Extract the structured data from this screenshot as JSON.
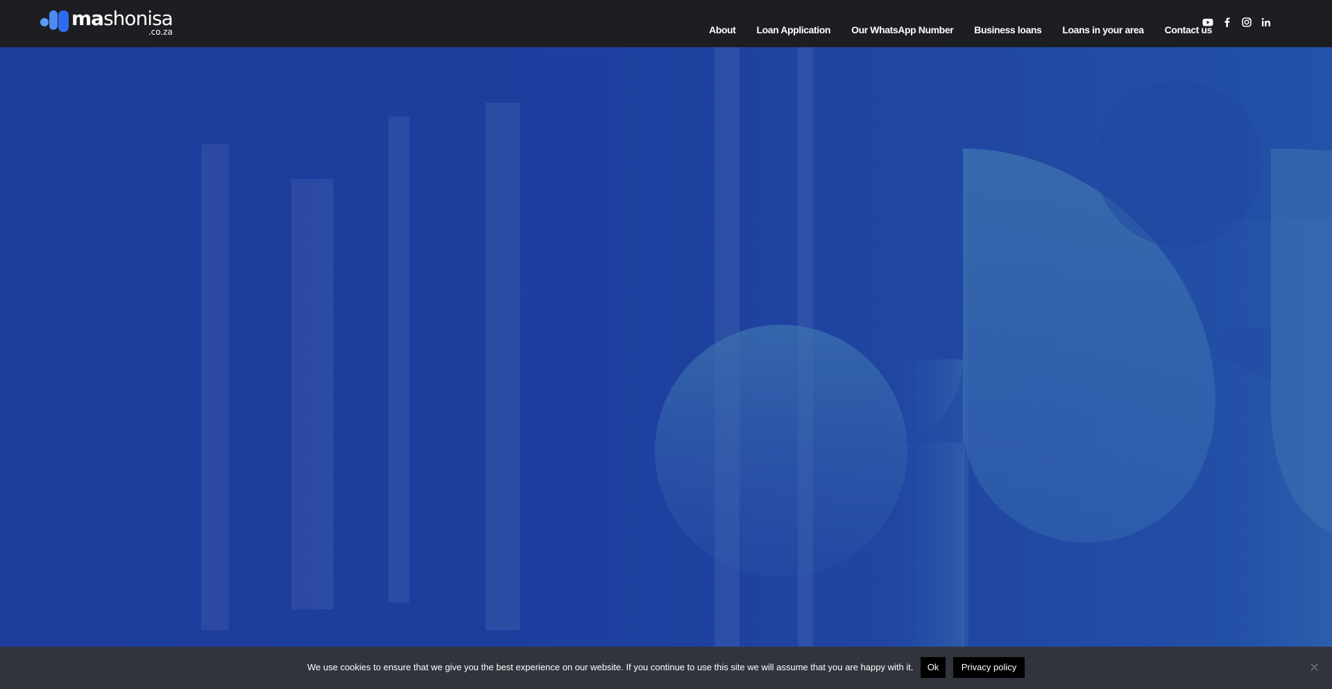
{
  "header": {
    "logo": {
      "text_bold": "ma",
      "text_regular": "shonisa",
      "suffix": ".co.za"
    },
    "nav": [
      {
        "label": "About"
      },
      {
        "label": "Loan Application"
      },
      {
        "label": "Our WhatsApp Number"
      },
      {
        "label": "Business loans"
      },
      {
        "label": "Loans in your area"
      },
      {
        "label": "Contact us"
      }
    ],
    "social": [
      {
        "icon": "youtube-icon"
      },
      {
        "icon": "facebook-icon"
      },
      {
        "icon": "instagram-icon"
      },
      {
        "icon": "linkedin-icon"
      }
    ]
  },
  "cookie_notice": {
    "text": "We use cookies to ensure that we give you the best experience on our website. If you continue to use this site we will assume that you are happy with it.",
    "ok_label": "Ok",
    "privacy_label": "Privacy policy",
    "close_icon": "close-icon"
  },
  "colors": {
    "header_bg": "#1d1e21",
    "hero_bg": "#1e3f9f",
    "cookie_bg": "#32343d",
    "button_bg": "#000000",
    "logo_accent": "#4d8cf5"
  }
}
